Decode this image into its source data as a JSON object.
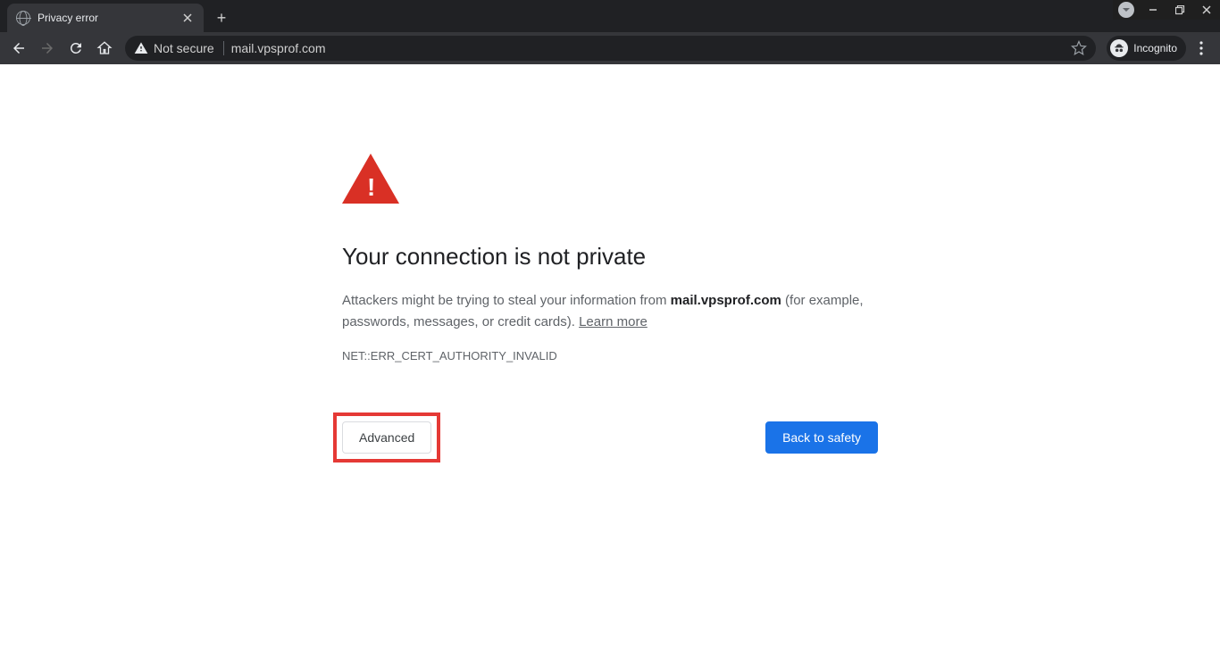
{
  "window": {
    "tab_title": "Privacy error"
  },
  "toolbar": {
    "security_label": "Not secure",
    "url": "mail.vpsprof.com",
    "incognito_label": "Incognito"
  },
  "interstitial": {
    "heading": "Your connection is not private",
    "body_pre": "Attackers might be trying to steal your information from ",
    "body_domain": "mail.vpsprof.com",
    "body_post": " (for example, passwords, messages, or credit cards). ",
    "learn_more": "Learn more",
    "error_code": "NET::ERR_CERT_AUTHORITY_INVALID",
    "advanced_label": "Advanced",
    "back_label": "Back to safety"
  }
}
